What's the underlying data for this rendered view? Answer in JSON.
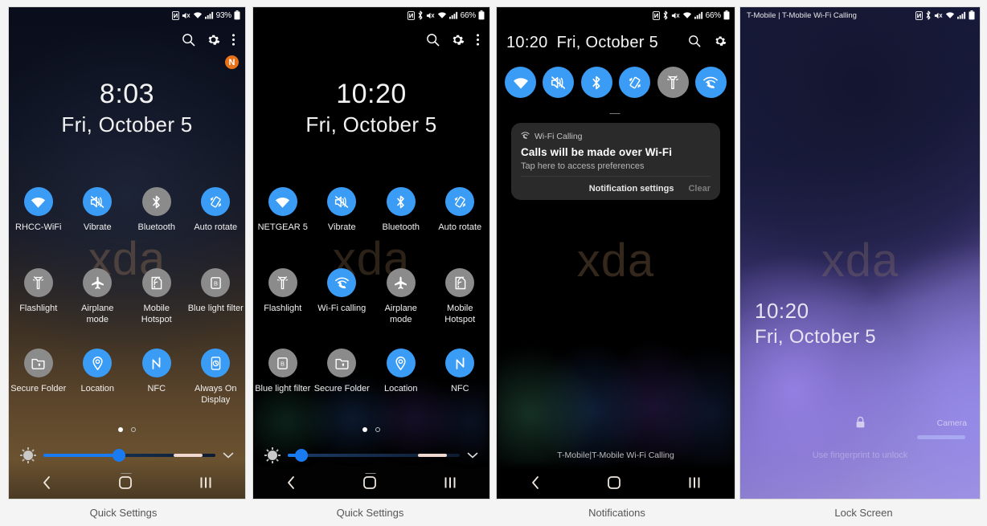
{
  "captions": [
    {
      "label": "Quick Settings"
    },
    {
      "label": "Quick Settings"
    },
    {
      "label": "Notifications"
    },
    {
      "label": "Lock Screen"
    }
  ],
  "panel1": {
    "statusbar": {
      "battery_pct": "93%",
      "icons": [
        "nfc-icon",
        "mute-icon",
        "wifi-icon",
        "signal-icon",
        "battery-icon"
      ]
    },
    "header": {
      "search": "search-icon",
      "settings": "gear-icon",
      "overflow": "more-vertical-icon",
      "badge": "N"
    },
    "clock": {
      "time": "8:03",
      "date": "Fri, October 5"
    },
    "watermark": "xda",
    "tiles": [
      {
        "label": "RHCC-WiFi",
        "icon": "wifi-icon",
        "state": "on"
      },
      {
        "label": "Vibrate",
        "icon": "vibrate-icon",
        "state": "on"
      },
      {
        "label": "Bluetooth",
        "icon": "bluetooth-icon",
        "state": "off"
      },
      {
        "label": "Auto rotate",
        "icon": "auto-rotate-icon",
        "state": "on"
      },
      {
        "label": "Flashlight",
        "icon": "flashlight-icon",
        "state": "off"
      },
      {
        "label": "Airplane mode",
        "icon": "airplane-icon",
        "state": "off"
      },
      {
        "label": "Mobile Hotspot",
        "icon": "hotspot-icon",
        "state": "off"
      },
      {
        "label": "Blue light filter",
        "icon": "blue-light-icon",
        "state": "off"
      },
      {
        "label": "Secure Folder",
        "icon": "secure-folder-icon",
        "state": "off"
      },
      {
        "label": "Location",
        "icon": "location-icon",
        "state": "on"
      },
      {
        "label": "NFC",
        "icon": "nfc-icon",
        "state": "on"
      },
      {
        "label": "Always On Display",
        "icon": "always-on-display-icon",
        "state": "on"
      }
    ],
    "brightness": {
      "value_pct": 44,
      "pages": 2,
      "active_page": 1
    },
    "nav": {
      "back": "back-icon",
      "home": "home-icon",
      "recents": "recents-icon"
    }
  },
  "panel2": {
    "statusbar": {
      "battery_pct": "66%",
      "icons": [
        "nfc-icon",
        "bluetooth-icon",
        "mute-icon",
        "wifi-icon",
        "signal-icon",
        "battery-icon"
      ]
    },
    "header": {
      "search": "search-icon",
      "settings": "gear-icon",
      "overflow": "more-vertical-icon"
    },
    "clock": {
      "time": "10:20",
      "date": "Fri, October 5"
    },
    "watermark": "xda",
    "tiles": [
      {
        "label": "NETGEAR 5",
        "icon": "wifi-icon",
        "state": "on"
      },
      {
        "label": "Vibrate",
        "icon": "vibrate-icon",
        "state": "on"
      },
      {
        "label": "Bluetooth",
        "icon": "bluetooth-icon",
        "state": "on"
      },
      {
        "label": "Auto rotate",
        "icon": "auto-rotate-icon",
        "state": "on"
      },
      {
        "label": "Flashlight",
        "icon": "flashlight-icon",
        "state": "off"
      },
      {
        "label": "Wi-Fi calling",
        "icon": "wifi-calling-icon",
        "state": "on"
      },
      {
        "label": "Airplane mode",
        "icon": "airplane-icon",
        "state": "off"
      },
      {
        "label": "Mobile Hotspot",
        "icon": "hotspot-icon",
        "state": "off"
      },
      {
        "label": "Blue light filter",
        "icon": "blue-light-icon",
        "state": "off"
      },
      {
        "label": "Secure Folder",
        "icon": "secure-folder-icon",
        "state": "off"
      },
      {
        "label": "Location",
        "icon": "location-icon",
        "state": "on"
      },
      {
        "label": "NFC",
        "icon": "nfc-icon",
        "state": "on"
      }
    ],
    "brightness": {
      "value_pct": 8,
      "pages": 2,
      "active_page": 1
    },
    "nav": {
      "back": "back-icon",
      "home": "home-icon",
      "recents": "recents-icon"
    }
  },
  "panel3": {
    "statusbar": {
      "battery_pct": "66%",
      "icons": [
        "nfc-icon",
        "bluetooth-icon",
        "mute-icon",
        "wifi-icon",
        "signal-icon",
        "battery-icon"
      ]
    },
    "header": {
      "time": "10:20",
      "date": "Fri, October 5",
      "search": "search-icon",
      "settings": "gear-icon"
    },
    "tiles": [
      {
        "icon": "wifi-icon",
        "state": "on"
      },
      {
        "icon": "vibrate-icon",
        "state": "on"
      },
      {
        "icon": "bluetooth-icon",
        "state": "on"
      },
      {
        "icon": "auto-rotate-icon",
        "state": "on"
      },
      {
        "icon": "flashlight-icon",
        "state": "off"
      },
      {
        "icon": "wifi-calling-icon",
        "state": "on"
      }
    ],
    "notification": {
      "app_icon": "wifi-calling-icon",
      "app_name": "Wi-Fi Calling",
      "title": "Calls will be made over Wi-Fi",
      "subtitle": "Tap here to access preferences",
      "action_primary": "Notification settings",
      "action_secondary": "Clear"
    },
    "watermark": "xda",
    "carrier": "T-Mobile|T-Mobile Wi-Fi Calling",
    "nav": {
      "back": "back-icon",
      "home": "home-icon",
      "recents": "recents-icon"
    }
  },
  "panel4": {
    "statusbar": {
      "carrier": "T-Mobile | T-Mobile Wi-Fi Calling",
      "icons": [
        "nfc-icon",
        "bluetooth-icon",
        "mute-icon",
        "wifi-icon",
        "signal-icon",
        "battery-icon"
      ]
    },
    "watermark": "xda",
    "clock": {
      "time": "10:20",
      "date": "Fri, October 5"
    },
    "lock_icon": "lock-icon",
    "hint": "Use fingerprint to unlock",
    "camera_label": "Camera"
  },
  "colors": {
    "accent_on": "#3b9cf6",
    "tile_off": "#8b8b8b",
    "badge": "#e8711a",
    "slider": "#1a7af0"
  }
}
